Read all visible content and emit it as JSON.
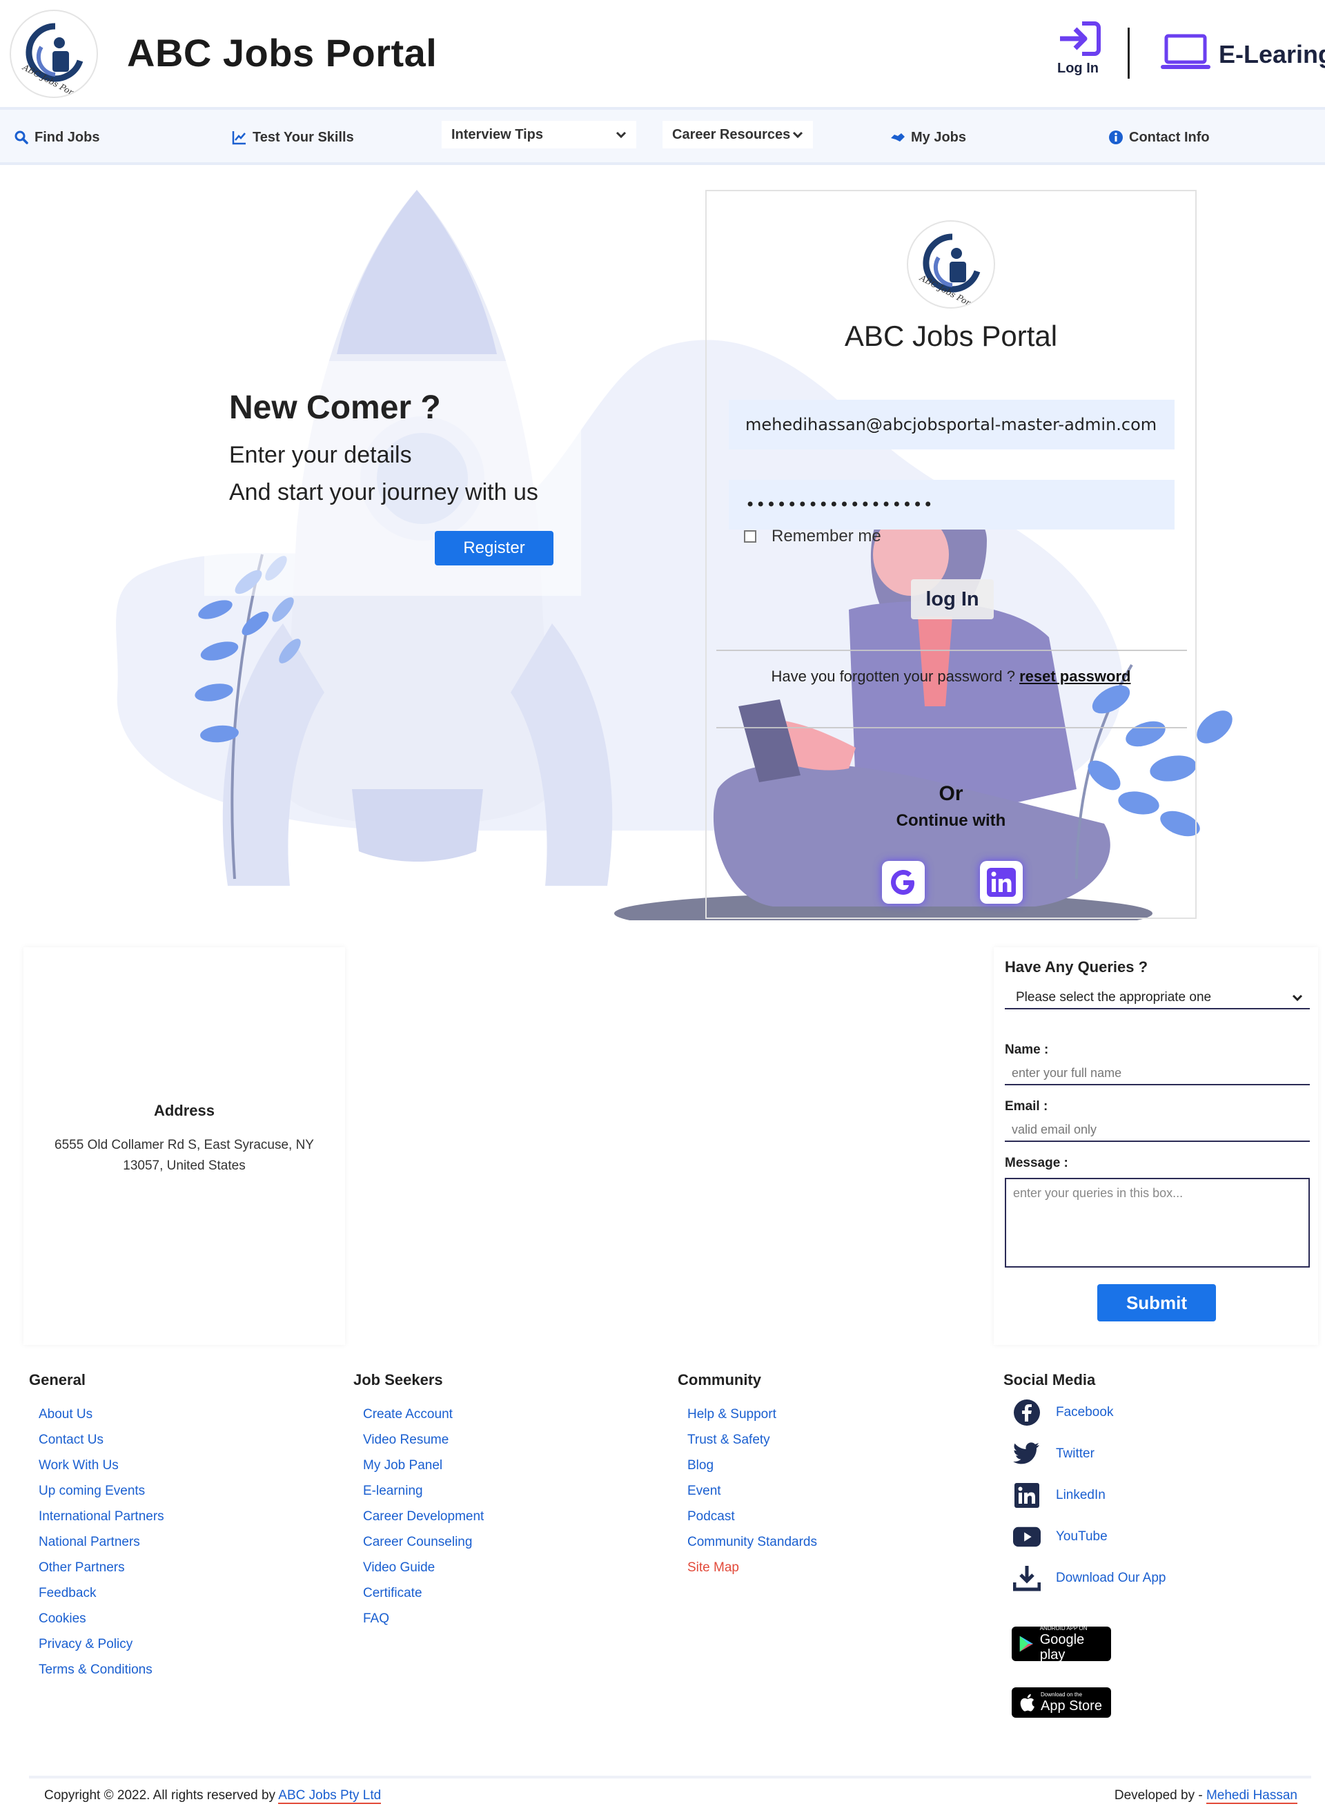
{
  "header": {
    "title": "ABC Jobs Portal",
    "login_label": "Log In",
    "elearning_label": "E-Learing",
    "logo_text": "ABC Jobs Portal"
  },
  "nav": {
    "find_jobs": "Find Jobs",
    "test_skills": "Test Your Skills",
    "interview_tips": "Interview Tips",
    "career_resources": "Career Resources",
    "my_jobs": "My Jobs",
    "contact_info": "Contact Info"
  },
  "hero": {
    "heading": "New Comer ?",
    "line1": "Enter your details",
    "line2": "And start your journey with us",
    "register_label": "Register"
  },
  "login": {
    "title": "ABC Jobs Portal",
    "email_value": "mehedihassan@abcjobsportal-master-admin.com",
    "password_value": "••••••••••••••••••",
    "remember_label": "Remember me",
    "login_label": "log In",
    "forgot_text": "Have you forgotten your password ?",
    "reset_label": "reset password",
    "or_text": "Or",
    "continue_text": "Continue with"
  },
  "address": {
    "title": "Address",
    "text": "6555 Old Collamer Rd S, East Syracuse, NY 13057, United States"
  },
  "query": {
    "title": "Have Any Queries ?",
    "select_value": "Please select the appropriate one",
    "name_label": "Name :",
    "name_placeholder": "enter your full name",
    "email_label": "Email :",
    "email_placeholder": "valid email only",
    "message_label": "Message :",
    "message_placeholder": "enter your queries in this box...",
    "submit_label": "Submit"
  },
  "footer": {
    "general": {
      "title": "General",
      "items": [
        "About Us",
        "Contact Us",
        "Work With Us",
        "Up coming Events",
        "International Partners",
        "National Partners",
        "Other Partners",
        "Feedback",
        "Cookies",
        "Privacy & Policy",
        "Terms & Conditions"
      ]
    },
    "job_seekers": {
      "title": "Job Seekers",
      "items": [
        "Create Account",
        "Video Resume",
        "My Job Panel",
        "E-learning",
        "Career Development",
        "Career Counseling",
        "Video Guide",
        "Certificate",
        "FAQ"
      ]
    },
    "community": {
      "title": "Community",
      "items": [
        "Help & Support",
        "Trust & Safety",
        "Blog",
        "Event",
        "Podcast",
        "Community Standards",
        "Site Map"
      ]
    },
    "social": {
      "title": "Social Media",
      "items": [
        "Facebook",
        "Twitter",
        "LinkedIn",
        "YouTube",
        "Download Our App"
      ]
    },
    "google_play_small": "ANDROID APP ON",
    "google_play_big": "Google play",
    "app_store_small": "Download on the",
    "app_store_big": "App Store"
  },
  "copyright": {
    "text": "Copyright © 2022. All rights reserved by",
    "company": "ABC Jobs Pty Ltd",
    "dev_text": "Developed by -",
    "developer": "Mehedi Hassan"
  },
  "colors": {
    "accent": "#1a73e8",
    "link": "#1a5fd0",
    "illustration": "#7b86d8",
    "nav_bg": "#f4f7fd"
  }
}
